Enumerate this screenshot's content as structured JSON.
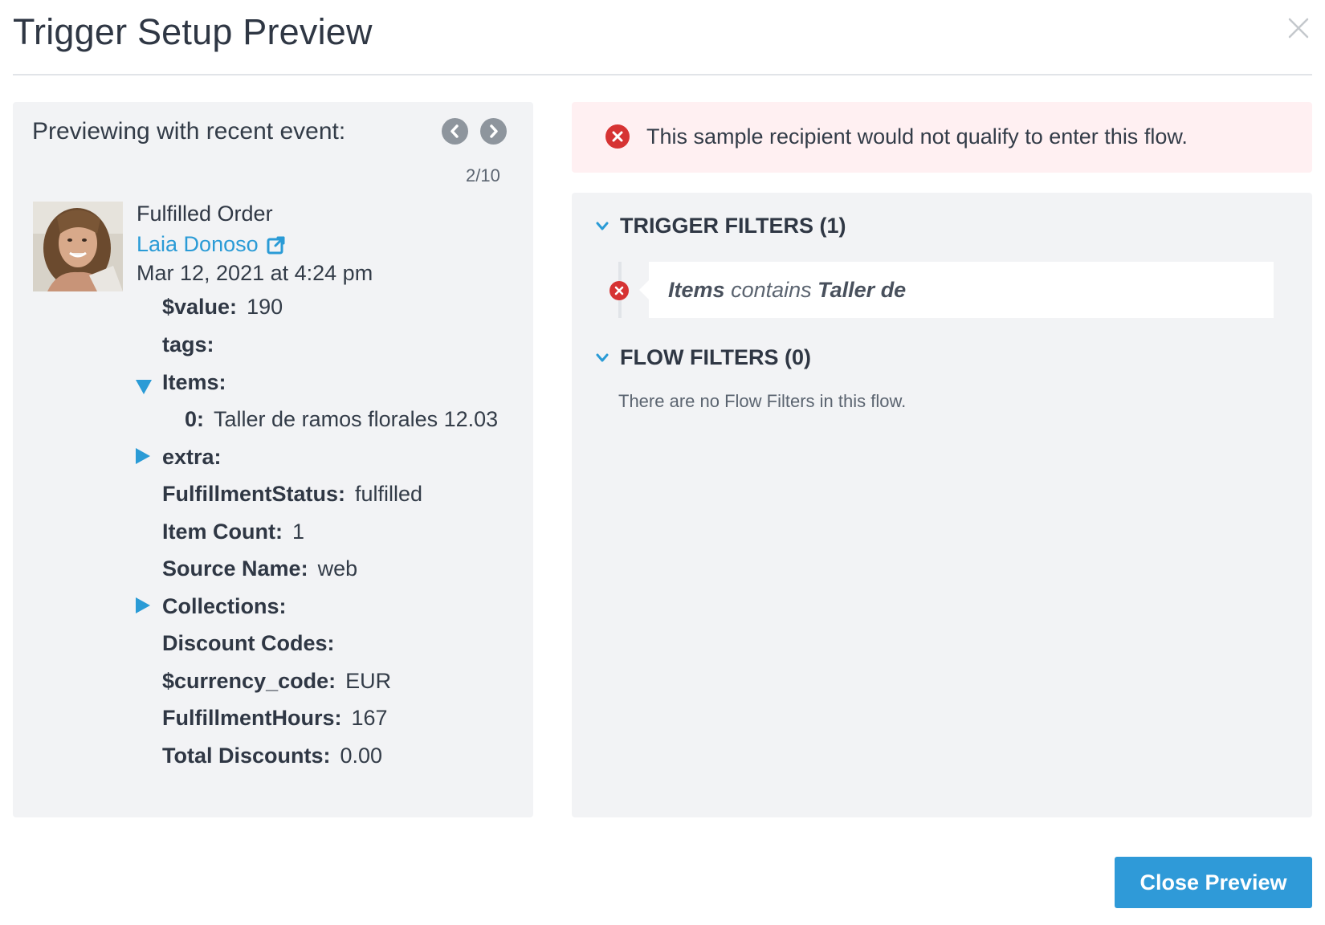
{
  "modal": {
    "title": "Trigger Setup Preview",
    "close_icon": "close-icon"
  },
  "left": {
    "preview_label": "Previewing with recent event:",
    "prev_icon": "chevron-left-icon",
    "next_icon": "chevron-right-icon",
    "page_counter": "2/10",
    "event_name": "Fulfilled Order",
    "person_name": "Laia Donoso",
    "person_link_icon": "external-link-icon",
    "event_date": "Mar 12, 2021 at 4:24 pm",
    "properties": {
      "value": {
        "key": "$value:",
        "val": "190"
      },
      "tags": {
        "key": "tags:",
        "val": ""
      },
      "items": {
        "key": "Items:",
        "expanded": true
      },
      "item0": {
        "key": "0:",
        "val": "Taller de ramos florales 12.03"
      },
      "extra": {
        "key": "extra:",
        "expanded": false
      },
      "fulfillment_status": {
        "key": "FulfillmentStatus:",
        "val": "fulfilled"
      },
      "item_count": {
        "key": "Item Count:",
        "val": "1"
      },
      "source_name": {
        "key": "Source Name:",
        "val": "web"
      },
      "collections": {
        "key": "Collections:",
        "expanded": false
      },
      "discount_codes": {
        "key": "Discount Codes:",
        "val": ""
      },
      "currency_code": {
        "key": "$currency_code:",
        "val": "EUR"
      },
      "fulfillment_hours": {
        "key": "FulfillmentHours:",
        "val": "167"
      },
      "total_discounts": {
        "key": "Total Discounts:",
        "val": "0.00"
      }
    }
  },
  "alert": {
    "icon": "error-circle-icon",
    "text": "This sample recipient would not qualify to enter this flow.",
    "background": "#fff0f2",
    "icon_color": "#d63333"
  },
  "trigger_filters": {
    "heading": "TRIGGER FILTERS (1)",
    "filter": {
      "field": "Items",
      "operator": "contains",
      "value": "Taller de"
    }
  },
  "flow_filters": {
    "heading": "FLOW FILTERS (0)",
    "empty_text": "There are no Flow Filters in this flow."
  },
  "footer": {
    "close_label": "Close Preview",
    "accent": "#2f9ad8"
  }
}
